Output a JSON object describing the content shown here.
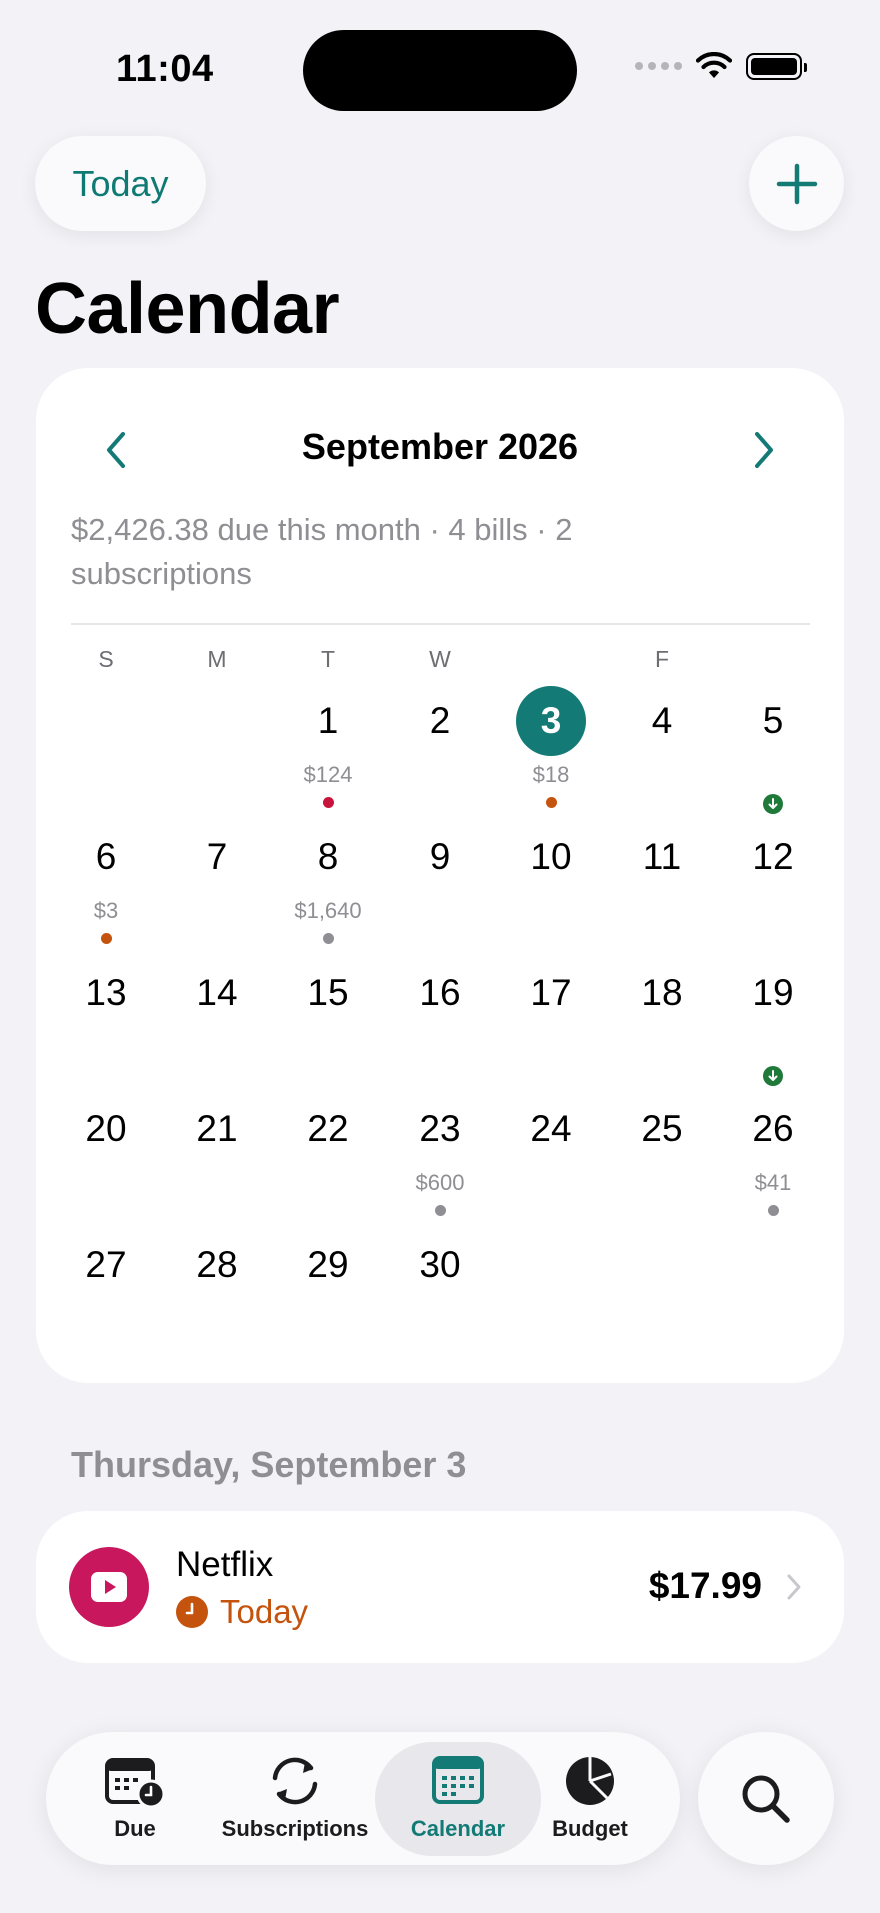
{
  "status_bar": {
    "time": "11:04"
  },
  "header": {
    "today_label": "Today",
    "title": "Calendar"
  },
  "calendar": {
    "month_title": "September 2026",
    "summary": "$2,426.38 due this month · 4 bills · 2 subscriptions",
    "weekdays": [
      "S",
      "M",
      "T",
      "W",
      "",
      "F",
      ""
    ],
    "days": [
      "1",
      "2",
      "3",
      "4",
      "5",
      "6",
      "7",
      "8",
      "9",
      "10",
      "11",
      "12",
      "13",
      "14",
      "15",
      "16",
      "17",
      "18",
      "19",
      "20",
      "21",
      "22",
      "23",
      "24",
      "25",
      "26",
      "27",
      "28",
      "29",
      "30"
    ],
    "amounts": {
      "d1": "$124",
      "d3": "$18",
      "d6": "$3",
      "d8": "$1,640",
      "d23": "$600",
      "d26": "$41"
    },
    "colors": {
      "accent": "#137a76",
      "overdue": "#c8143c",
      "due_soon": "#c4530e",
      "scheduled": "#8e8e93",
      "income": "#1f7a3a"
    }
  },
  "selected": {
    "date_heading": "Thursday, September 3",
    "bill": {
      "name": "Netflix",
      "due_label": "Today",
      "amount": "$17.99",
      "icon": "play-icon",
      "color": "#c8175d"
    }
  },
  "tabbar": {
    "tabs": [
      {
        "label": "Due",
        "icon": "calendar-clock-icon"
      },
      {
        "label": "Subscriptions",
        "icon": "arrows-cycle-icon"
      },
      {
        "label": "Calendar",
        "icon": "calendar-icon",
        "active": true
      },
      {
        "label": "Budget",
        "icon": "pie-chart-icon"
      }
    ],
    "search_icon": "search-icon"
  }
}
